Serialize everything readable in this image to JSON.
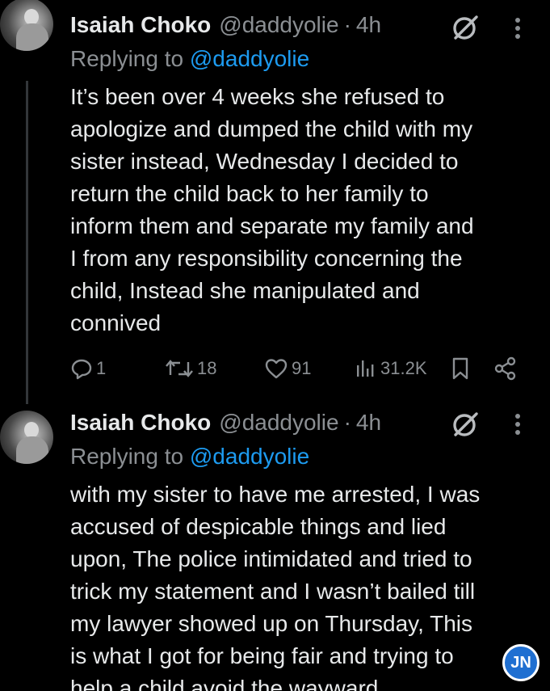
{
  "tweets": [
    {
      "name": "Isaiah Choko",
      "handle": "@daddyolie",
      "separator": "·",
      "time": "4h",
      "replying_prefix": "Replying to",
      "replying_mention": "@daddyolie",
      "text_lines": [
        "It’s been over 4 weeks she refused to",
        "apologize and dumped the child with my",
        "sister instead, Wednesday I decided to",
        "return the child back to her family to",
        "inform them and separate my family and",
        "I from any responsibility concerning the",
        "child, Instead she manipulated and",
        "connived"
      ],
      "reply_count": "1",
      "repost_count": "18",
      "like_count": "91",
      "view_count": "31.2K"
    },
    {
      "name": "Isaiah Choko",
      "handle": "@daddyolie",
      "separator": "·",
      "time": "4h",
      "replying_prefix": "Replying to",
      "replying_mention": "@daddyolie",
      "text_lines": [
        "with my sister to have me arrested, I was",
        "accused of despicable things and lied",
        "upon, The police intimidated and tried to",
        "trick my statement and I wasn’t bailed till",
        "my lawyer showed up on Thursday, This",
        "is what I got for being fair and trying to",
        "help a child avoid the wayward"
      ]
    }
  ],
  "icons": {
    "reply": "reply-icon",
    "repost": "repost-icon",
    "like": "heart-icon",
    "views": "views-icon",
    "bookmark": "bookmark-icon",
    "share": "share-icon",
    "grok": "grok-icon",
    "more": "more-icon"
  },
  "watermark": "JN",
  "colors": {
    "background": "#000000",
    "text": "#e7e9ea",
    "muted": "#8b8f93",
    "link": "#1d9bf0"
  }
}
